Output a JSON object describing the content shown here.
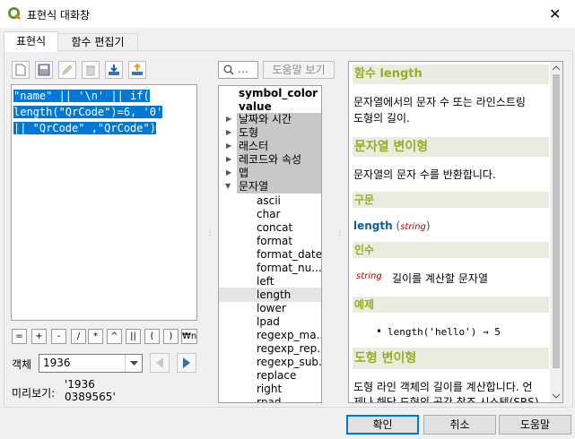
{
  "window": {
    "title": "표현식 대화창",
    "close_label": "✕"
  },
  "tabs": [
    {
      "label": "표현식"
    },
    {
      "label": "함수 편집기"
    }
  ],
  "editor": {
    "lines": [
      "\"name\" || '\\n' || if(",
      "length(\"QrCode\")=6, '0'",
      "|| \"QrCode\" ,\"QrCode\")"
    ]
  },
  "operators": [
    "=",
    "+",
    "-",
    "/",
    "*",
    "^",
    "||",
    "(",
    ")",
    "₩n"
  ],
  "feature": {
    "label": "객체",
    "value": "1936"
  },
  "preview": {
    "label": "미리보기:",
    "value_line1": "'1936",
    "value_line2": "0389565'"
  },
  "search": {
    "placeholder": ""
  },
  "help_button": "도움말 보기",
  "tree": {
    "top_items": [
      "symbol_color",
      "value"
    ],
    "groups": [
      "날짜와 시간",
      "도형",
      "래스터",
      "레코드와 속성",
      "맵",
      "문자열"
    ],
    "functions": [
      "ascii",
      "char",
      "concat",
      "format",
      "format_date",
      "format_nu...",
      "left",
      "length",
      "lower",
      "lpad",
      "regexp_ma...",
      "regexp_rep...",
      "regexp_sub...",
      "replace",
      "right",
      "rpad"
    ],
    "selected": "length"
  },
  "help": {
    "title": "함수 length",
    "desc1": "문자열에서의 문자 수 또는 라인스트링",
    "desc2": "도형의 길이.",
    "variant1_title": "문자열 변이형",
    "variant1_desc": "문자열의 문자 수를 반환합니다.",
    "syntax_label": "구문",
    "syntax_func": "length",
    "syntax_arg": "string",
    "args_label": "인수",
    "arg_name": "string",
    "arg_desc": "길이를 계산할 문자열",
    "examples_label": "예제",
    "example": "length('hello') → 5",
    "variant2_title": "도형 변이형",
    "variant2_desc1": "도형 라인 객체의 길이를 계산합니다. 언",
    "variant2_desc2": "제나 해당 도형의 공간 참조 시스템(SRS)"
  },
  "buttons": {
    "ok": "확인",
    "cancel": "취소",
    "help": "도움말"
  }
}
